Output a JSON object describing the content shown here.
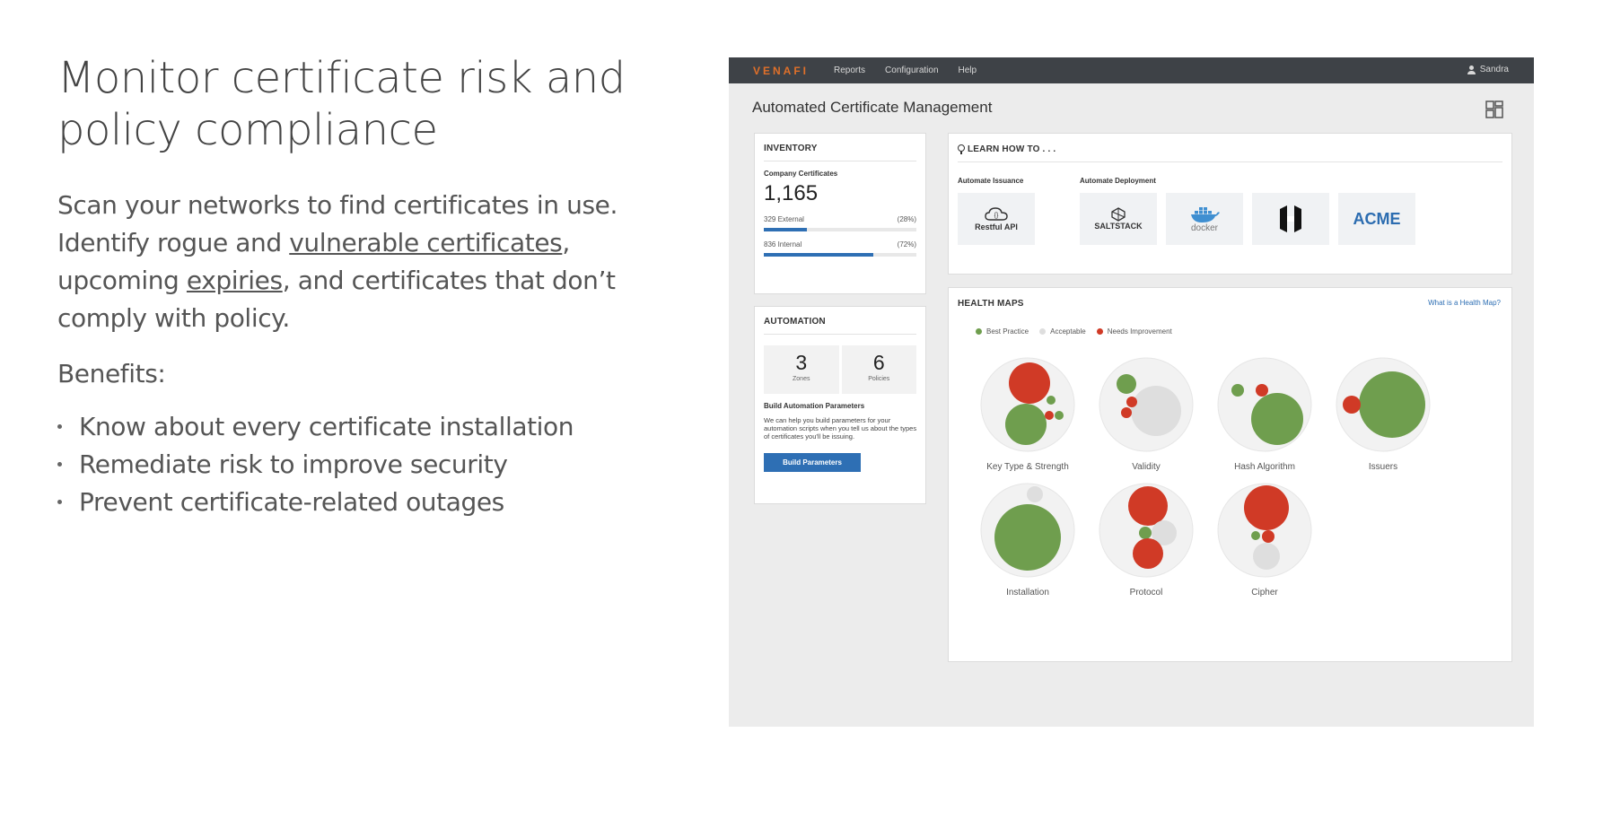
{
  "copy": {
    "headline_line1": "Monitor certificate risk and",
    "headline_line2": "policy compliance",
    "lead_part1": "Scan your networks to find certificates in use. Identify rogue and ",
    "lead_link1": "vulnerable certificates",
    "lead_part2": ", upcoming ",
    "lead_link2": "expiries",
    "lead_part3": ", and certificates that don’t comply with policy.",
    "benefits_label": "Benefits:",
    "benefits": [
      "Know about every certificate installation",
      "Remediate risk to improve security",
      "Prevent certificate-related outages"
    ]
  },
  "app": {
    "brand": "VENAFI",
    "nav": [
      "Reports",
      "Configuration",
      "Help"
    ],
    "user": "Sandra",
    "page_title": "Automated Certificate Management",
    "inventory": {
      "title": "INVENTORY",
      "subtitle": "Company Certificates",
      "total": "1,165",
      "external_label": "329 External",
      "external_pct": "(28%)",
      "external_fraction": 0.28,
      "internal_label": "836 Internal",
      "internal_pct": "(72%)",
      "internal_fraction": 0.72
    },
    "automation": {
      "title": "AUTOMATION",
      "zones_count": "3",
      "zones_label": "Zones",
      "policies_count": "6",
      "policies_label": "Policies",
      "build_heading": "Build Automation Parameters",
      "build_text": "We can help you build parameters for your automation scripts when you tell us about the types of certificates you'll be issuing.",
      "button": "Build Parameters"
    },
    "learn": {
      "title": "LEARN HOW TO . . .",
      "issuance_label": "Automate Issuance",
      "deployment_label": "Automate Deployment",
      "tiles": {
        "restful": "Restful API",
        "saltstack": "SALTSTACK",
        "docker": "docker",
        "acme": "ACME"
      }
    },
    "health": {
      "title": "HEALTH MAPS",
      "link": "What is a Health Map?",
      "legend": {
        "best": "Best Practice",
        "acceptable": "Acceptable",
        "needs": "Needs Improvement"
      },
      "colors": {
        "best": "#6f9e4e",
        "acceptable": "#dedede",
        "needs": "#d03a26"
      },
      "maps": [
        "Key Type & Strength",
        "Validity",
        "Hash Algorithm",
        "Issuers",
        "Installation",
        "Protocol",
        "Cipher"
      ]
    }
  }
}
